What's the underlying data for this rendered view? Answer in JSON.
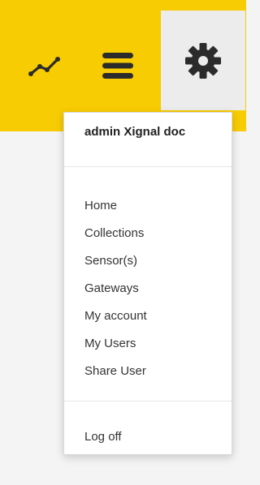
{
  "topbar": {
    "background_color": "#f8cc02",
    "icons": {
      "chart": "trend-line-icon",
      "menu": "hamburger-menu-icon",
      "settings": "gear-icon"
    }
  },
  "dropdown": {
    "header": "admin Xignal doc",
    "items": [
      {
        "label": "Home"
      },
      {
        "label": "Collections"
      },
      {
        "label": "Sensor(s)"
      },
      {
        "label": "Gateways"
      },
      {
        "label": "My account"
      },
      {
        "label": "My Users"
      },
      {
        "label": "Share User"
      }
    ],
    "logoff_label": "Log off"
  }
}
